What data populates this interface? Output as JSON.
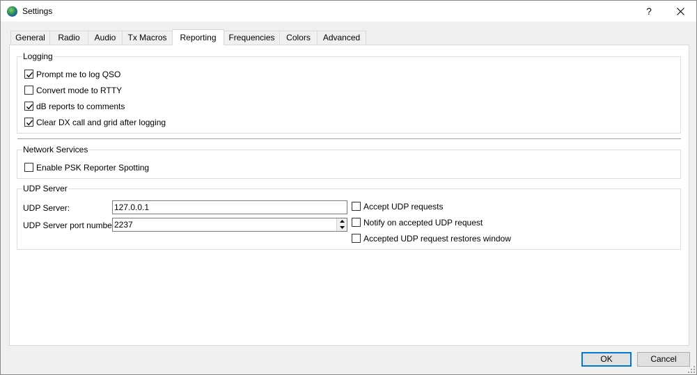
{
  "window": {
    "title": "Settings",
    "help": "?",
    "close_icon": "close-icon"
  },
  "tabs": [
    {
      "label": "General"
    },
    {
      "label": "Radio"
    },
    {
      "label": "Audio"
    },
    {
      "label": "Tx Macros"
    },
    {
      "label": "Reporting",
      "active": true
    },
    {
      "label": "Frequencies"
    },
    {
      "label": "Colors"
    },
    {
      "label": "Advanced"
    }
  ],
  "logging": {
    "title": "Logging",
    "items": [
      {
        "label": "Prompt me to log QSO",
        "checked": true
      },
      {
        "label": "Convert mode to RTTY",
        "checked": false
      },
      {
        "label": "dB reports to comments",
        "checked": true
      },
      {
        "label": "Clear DX call and grid after logging",
        "checked": true
      }
    ]
  },
  "network": {
    "title": "Network Services",
    "items": [
      {
        "label": "Enable PSK Reporter Spotting",
        "checked": false
      }
    ]
  },
  "udp": {
    "title": "UDP Server",
    "server_label": "UDP Server:",
    "server_value": "127.0.0.1",
    "port_label": "UDP Server port number:",
    "port_value": "2237",
    "options": [
      {
        "label": "Accept UDP requests",
        "checked": false
      },
      {
        "label": "Notify on accepted UDP request",
        "checked": false
      },
      {
        "label": "Accepted UDP request restores window",
        "checked": false
      }
    ]
  },
  "buttons": {
    "ok": "OK",
    "cancel": "Cancel"
  },
  "colors": {
    "accent": "#0078d7"
  }
}
